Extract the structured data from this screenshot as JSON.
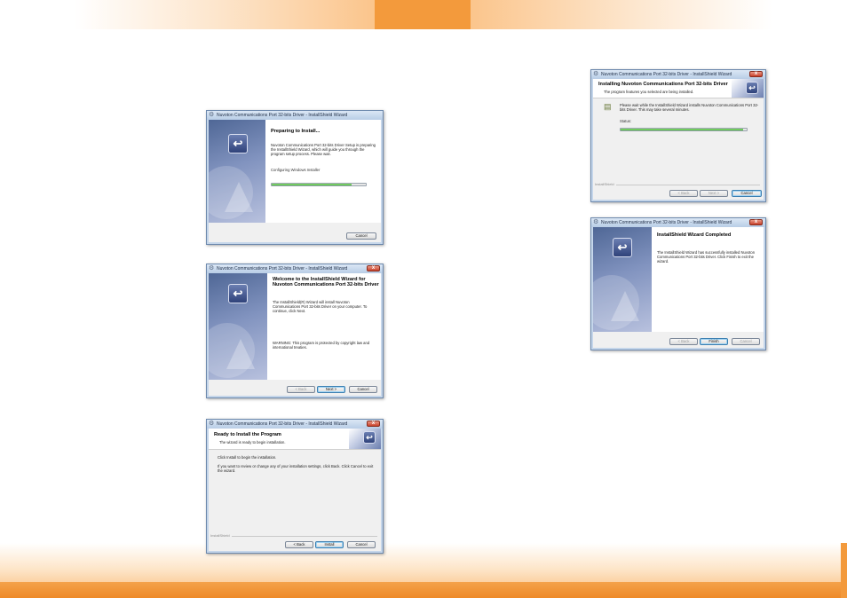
{
  "theme": {
    "accent": "#f39a3c",
    "window_border": "#6d89ad",
    "progress_green": "#38b02a"
  },
  "windows": {
    "preparing": {
      "title": "Nuvoton Communications Port 32-bits Driver - InstallShield Wizard",
      "heading": "Preparing to Install...",
      "body": "Nuvoton Communications Port 32-bits Driver Setup is preparing the InstallShield Wizard, which will guide you through the program setup process.  Please wait.",
      "status": "Configuring Windows Installer",
      "progress": 0.85,
      "cancel": "Cancel"
    },
    "welcome": {
      "title": "Nuvoton Communications Port 32-bits Driver - InstallShield Wizard",
      "heading": "Welcome to the InstallShield Wizard for Nuvoton Communications Port 32-bits Driver",
      "body": "The InstallShield(R) Wizard will install Nuvoton Communications Port 32-bits Driver on your computer. To continue, click Next.",
      "warning": "WARNING: This program is protected by copyright law and international treaties.",
      "back": "< Back",
      "next": "Next >",
      "cancel": "Cancel"
    },
    "ready": {
      "title": "Nuvoton Communications Port 32-bits Driver - InstallShield Wizard",
      "heading": "Ready to Install the Program",
      "subheading": "The wizard is ready to begin installation.",
      "line1": "Click Install to begin the installation.",
      "line2": "If you want to review or change any of your installation settings, click Back. Click Cancel to exit the wizard.",
      "brand": "InstallShield",
      "back": "< Back",
      "install": "Install",
      "cancel": "Cancel"
    },
    "installing": {
      "title": "Nuvoton Communications Port 32-bits Driver - InstallShield Wizard",
      "heading": "Installing Nuvoton Communications Port 32-bits Driver",
      "subheading": "The program features you selected are being installed.",
      "body": "Please wait while the InstallShield Wizard installs Nuvoton Communications Port 32-bits Driver. This may take several minutes.",
      "status_label": "Status:",
      "progress": 0.97,
      "brand": "InstallShield",
      "back": "< Back",
      "next": "Next >",
      "cancel": "Cancel"
    },
    "completed": {
      "title": "Nuvoton Communications Port 32-bits Driver - InstallShield Wizard",
      "heading": "InstallShield Wizard Completed",
      "body": "The InstallShield Wizard has successfully installed Nuvoton Communications Port 32-bits Driver. Click Finish to exit the wizard.",
      "back": "< Back",
      "finish": "Finish",
      "cancel": "Cancel"
    }
  }
}
